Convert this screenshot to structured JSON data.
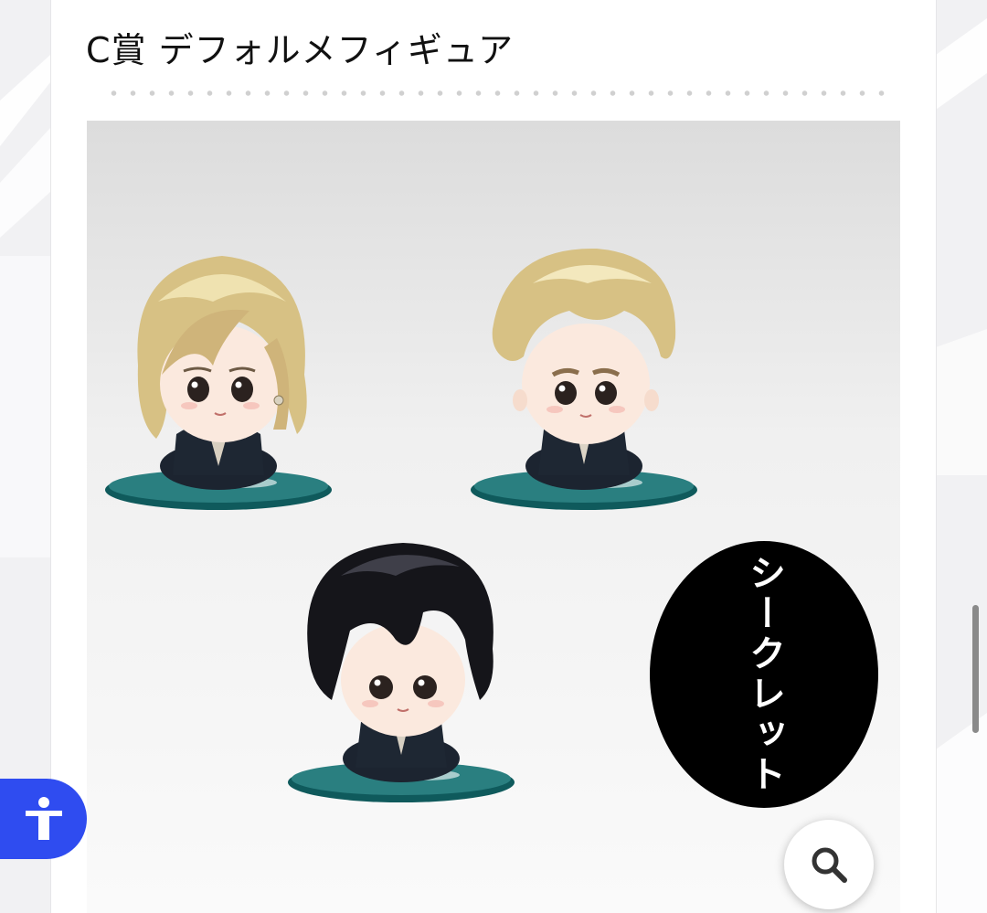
{
  "section": {
    "title": "C賞 デフォルメフィギュア"
  },
  "product": {
    "secret_label": "シークレット",
    "figures": [
      "blonde-long-hair-figure",
      "blonde-short-hair-figure",
      "black-hair-figure"
    ]
  },
  "icons": {
    "accessibility": "accessibility-icon",
    "zoom": "search-icon"
  },
  "colors": {
    "accessibility_button": "#2f4cf0",
    "base": "#1e6e6e",
    "secret_bg": "#000000"
  }
}
